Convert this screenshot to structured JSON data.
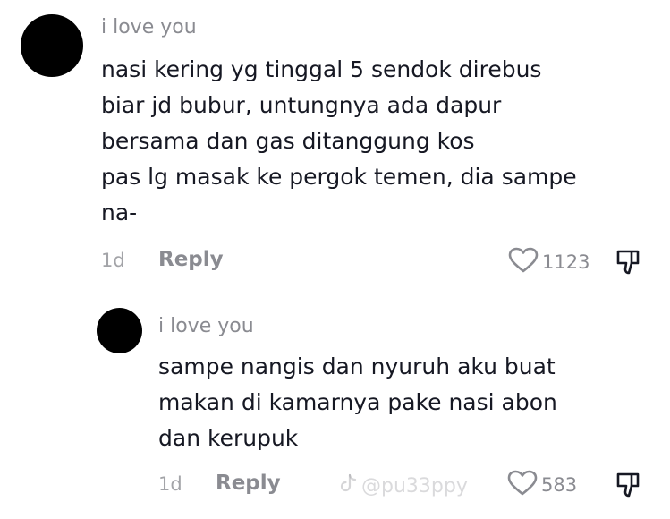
{
  "comment": {
    "username": "i love you",
    "lines": [
      "nasi kering yg tinggal 5 sendok direbus",
      "biar jd bubur, untungnya ada dapur",
      "bersama dan gas ditanggung kos",
      "pas lg masak ke pergok temen, dia sampe",
      "na-"
    ],
    "time": "1d",
    "reply_label": "Reply",
    "likes": "1123"
  },
  "reply": {
    "username": "i love you",
    "lines": [
      "sampe nangis dan nyuruh aku buat",
      "makan di kamarnya pake nasi abon",
      "dan kerupuk"
    ],
    "time": "1d",
    "reply_label": "Reply",
    "likes": "583"
  },
  "watermark": {
    "text": "@pu33ppy",
    "icon": "tiktok-logo-icon"
  },
  "colors": {
    "avatar": "#000000",
    "secondary_text": "#8a8b91",
    "primary_text": "#161823"
  }
}
